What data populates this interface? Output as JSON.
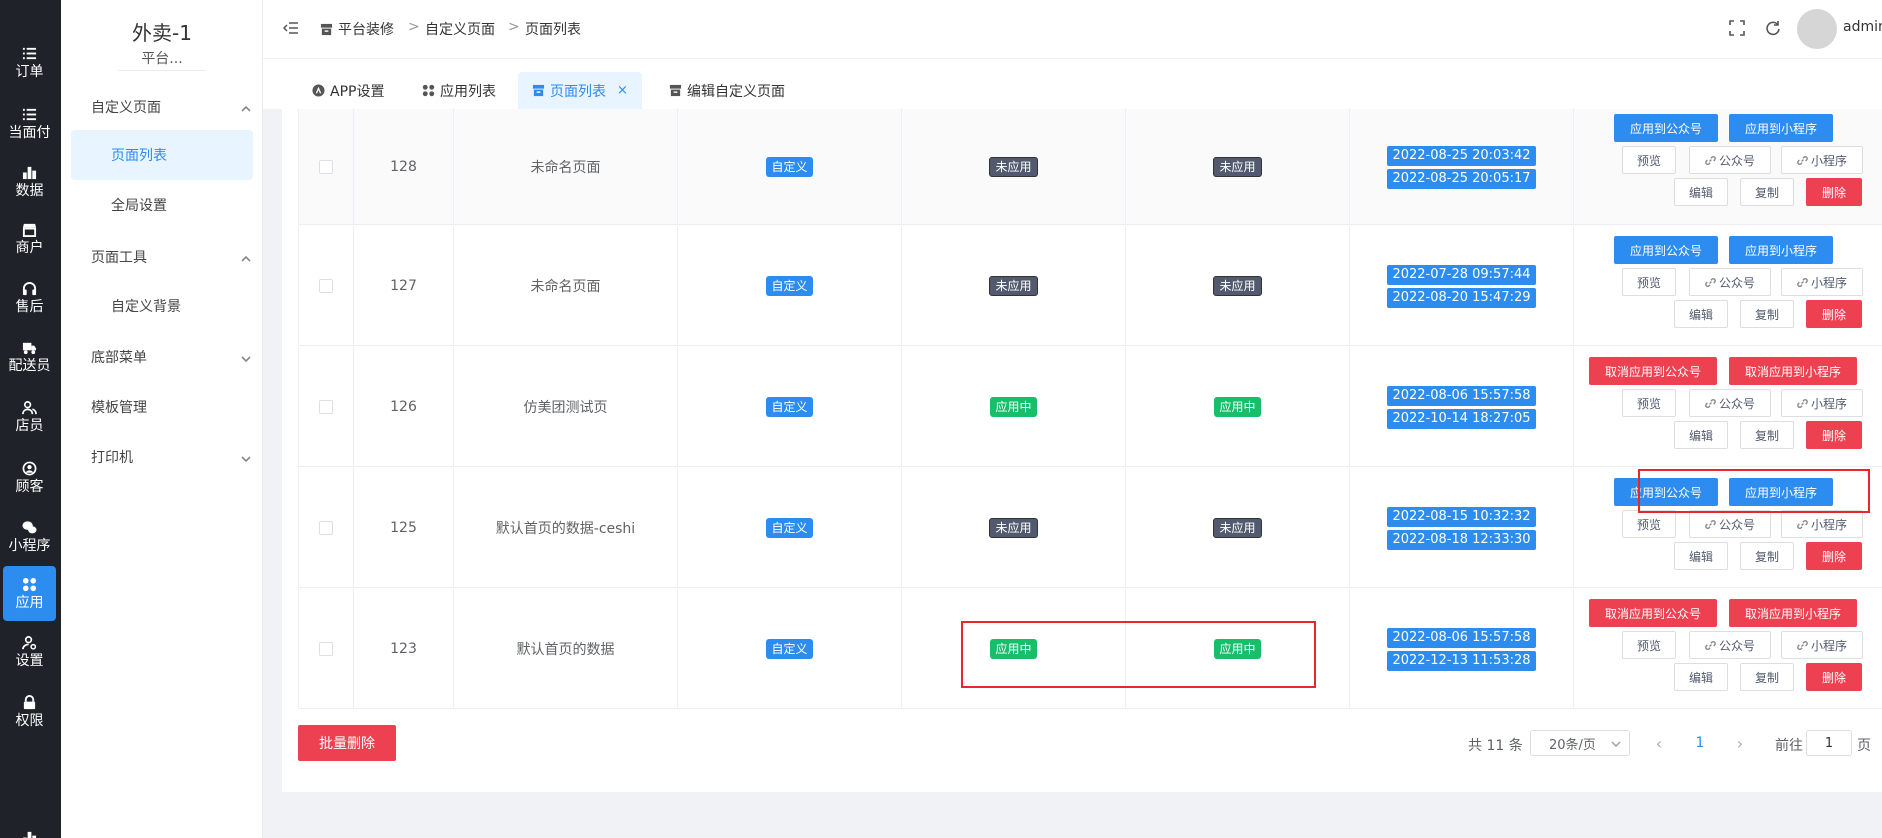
{
  "rail": {
    "items": [
      {
        "label": "订单",
        "icon": "list-icon"
      },
      {
        "label": "当面付",
        "icon": "list-icon"
      },
      {
        "label": "数据",
        "icon": "bar-chart-icon"
      },
      {
        "label": "商户",
        "icon": "shop-icon"
      },
      {
        "label": "售后",
        "icon": "headset-icon"
      },
      {
        "label": "配送员",
        "icon": "truck-icon"
      },
      {
        "label": "店员",
        "icon": "users-icon"
      },
      {
        "label": "顾客",
        "icon": "user-circle-icon"
      },
      {
        "label": "小程序",
        "icon": "wechat-icon"
      },
      {
        "label": "应用",
        "icon": "apps-icon"
      },
      {
        "label": "设置",
        "icon": "user-gear-icon"
      },
      {
        "label": "权限",
        "icon": "lock-icon"
      }
    ],
    "active_index": 9
  },
  "subnav": {
    "brand": "外卖-1",
    "brand_sub": "平台...",
    "groups": [
      {
        "label": "自定义页面",
        "expanded": true
      },
      {
        "label": "页面工具",
        "expanded": true
      },
      {
        "label": "底部菜单",
        "expanded": false
      },
      {
        "label": "模板管理",
        "expanded": null
      },
      {
        "label": "打印机",
        "expanded": false
      }
    ],
    "children": {
      "page_list": "页面列表",
      "global_settings": "全局设置",
      "custom_background": "自定义背景"
    }
  },
  "header": {
    "breadcrumb": [
      "平台装修",
      "自定义页面",
      "页面列表"
    ],
    "breadcrumb_sep": ">",
    "username": "admin"
  },
  "tabs": [
    {
      "label": "APP设置",
      "icon": "app-store-icon",
      "active": false
    },
    {
      "label": "应用列表",
      "icon": "apps-icon",
      "active": false
    },
    {
      "label": "页面列表",
      "icon": "archive-icon",
      "active": true,
      "close": "×"
    },
    {
      "label": "编辑自定义页面",
      "icon": "archive-icon",
      "active": false
    }
  ],
  "table": {
    "rows": [
      {
        "id": "128",
        "name": "未命名页面",
        "type": "自定义",
        "gzh_status": "未应用",
        "mp_status": "未应用",
        "created": "2022-08-25 20:03:42",
        "updated": "2022-08-25 20:05:17",
        "btn_gzh": "应用到公众号",
        "btn_mp": "应用到小程序"
      },
      {
        "id": "127",
        "name": "未命名页面",
        "type": "自定义",
        "gzh_status": "未应用",
        "mp_status": "未应用",
        "created": "2022-07-28 09:57:44",
        "updated": "2022-08-20 15:47:29",
        "btn_gzh": "应用到公众号",
        "btn_mp": "应用到小程序"
      },
      {
        "id": "126",
        "name": "仿美团测试页",
        "type": "自定义",
        "gzh_status": "应用中",
        "mp_status": "应用中",
        "created": "2022-08-06 15:57:58",
        "updated": "2022-10-14 18:27:05",
        "btn_gzh": "取消应用到公众号",
        "btn_mp": "取消应用到小程序"
      },
      {
        "id": "125",
        "name": "默认首页的数据-ceshi",
        "type": "自定义",
        "gzh_status": "未应用",
        "mp_status": "未应用",
        "created": "2022-08-15 10:32:32",
        "updated": "2022-08-18 12:33:30",
        "btn_gzh": "应用到公众号",
        "btn_mp": "应用到小程序"
      },
      {
        "id": "123",
        "name": "默认首页的数据",
        "type": "自定义",
        "gzh_status": "应用中",
        "mp_status": "应用中",
        "created": "2022-08-06 15:57:58",
        "updated": "2022-12-13 11:53:28",
        "btn_gzh": "取消应用到公众号",
        "btn_mp": "取消应用到小程序"
      }
    ],
    "common_buttons": {
      "preview": "预览",
      "gzh_link": "公众号",
      "mp_link": "小程序",
      "edit": "编辑",
      "copy": "复制",
      "delete": "删除"
    }
  },
  "footer": {
    "batch_delete": "批量删除",
    "total": "共 11 条",
    "page_size": "20条/页",
    "prev": "‹",
    "next": "›",
    "current_page": "1",
    "goto_label": "前往",
    "goto_value": "1",
    "goto_suffix": "页"
  },
  "colors": {
    "primary": "#2d8cf0",
    "danger": "#ed4050",
    "success": "#19be6b",
    "annotation": "#e8262b"
  }
}
